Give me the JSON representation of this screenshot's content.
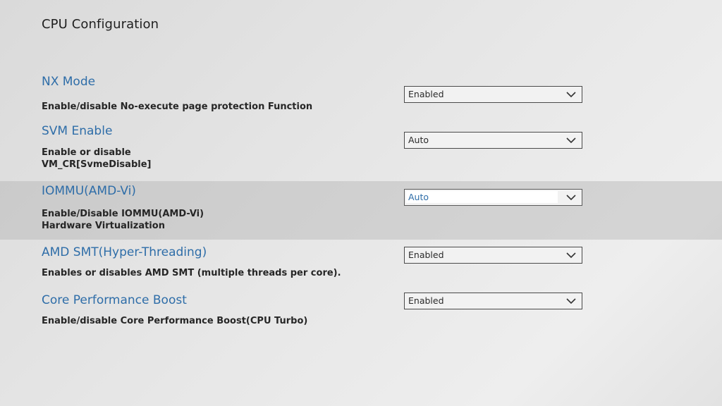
{
  "page": {
    "title": "CPU Configuration"
  },
  "settings": [
    {
      "name": "NX Mode",
      "description": [
        "Enable/disable No-execute page protection Function"
      ],
      "value": "Enabled"
    },
    {
      "name": "SVM Enable",
      "description": [
        "Enable or disable",
        "VM_CR[SvmeDisable]"
      ],
      "value": "Auto"
    },
    {
      "name": "IOMMU(AMD-Vi)",
      "description": [
        "Enable/Disable IOMMU(AMD-Vi)",
        "Hardware Virtualization"
      ],
      "value": "Auto",
      "selected": true
    },
    {
      "name": "AMD SMT(Hyper-Threading)",
      "description": [
        "Enables or disables AMD SMT (multiple threads per core)."
      ],
      "value": "Enabled"
    },
    {
      "name": "Core Performance Boost",
      "description": [
        "Enable/disable Core Performance Boost(CPU Turbo)"
      ],
      "value": "Enabled"
    }
  ],
  "icons": {
    "dropdown_indicator": "chevron-down-icon"
  },
  "colors": {
    "setting_name": "#2e6da8",
    "background": "#e4e4e4",
    "selected_row": "#cfcfcf"
  }
}
